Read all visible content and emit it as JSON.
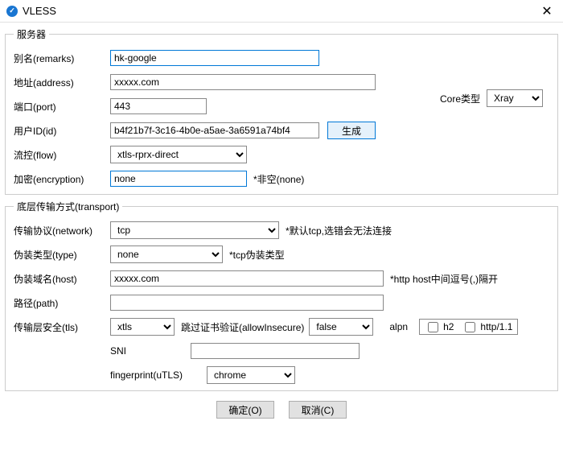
{
  "window": {
    "title": "VLESS",
    "close": "✕"
  },
  "server_group": {
    "legend": "服务器",
    "remarks_label": "别名(remarks)",
    "remarks_value": "hk-google",
    "core_label": "Core类型",
    "core_value": "Xray",
    "address_label": "地址(address)",
    "address_value": "xxxxx.com",
    "port_label": "端口(port)",
    "port_value": "443",
    "id_label": "用户ID(id)",
    "id_value": "b4f21b7f-3c16-4b0e-a5ae-3a6591a74bf4",
    "gen_btn": "生成",
    "flow_label": "流控(flow)",
    "flow_value": "xtls-rprx-direct",
    "encryption_label": "加密(encryption)",
    "encryption_value": "none",
    "encryption_hint": "*非空(none)"
  },
  "transport_group": {
    "legend": "底层传输方式(transport)",
    "network_label": "传输协议(network)",
    "network_value": "tcp",
    "network_hint": "*默认tcp,选错会无法连接",
    "type_label": "伪装类型(type)",
    "type_value": "none",
    "type_hint": "*tcp伪装类型",
    "host_label": "伪装域名(host)",
    "host_value": "xxxxx.com",
    "host_hint": "*http host中间逗号(,)隔开",
    "path_label": "路径(path)",
    "path_value": "",
    "tls_label": "传输层安全(tls)",
    "tls_value": "xtls",
    "allow_insecure_label": "跳过证书验证(allowInsecure)",
    "allow_insecure_value": "false",
    "alpn_label": "alpn",
    "alpn_h2": "h2",
    "alpn_http11": "http/1.1",
    "sni_label": "SNI",
    "sni_value": "",
    "fingerprint_label": "fingerprint(uTLS)",
    "fingerprint_value": "chrome"
  },
  "footer": {
    "ok": "确定(O)",
    "cancel": "取消(C)"
  }
}
